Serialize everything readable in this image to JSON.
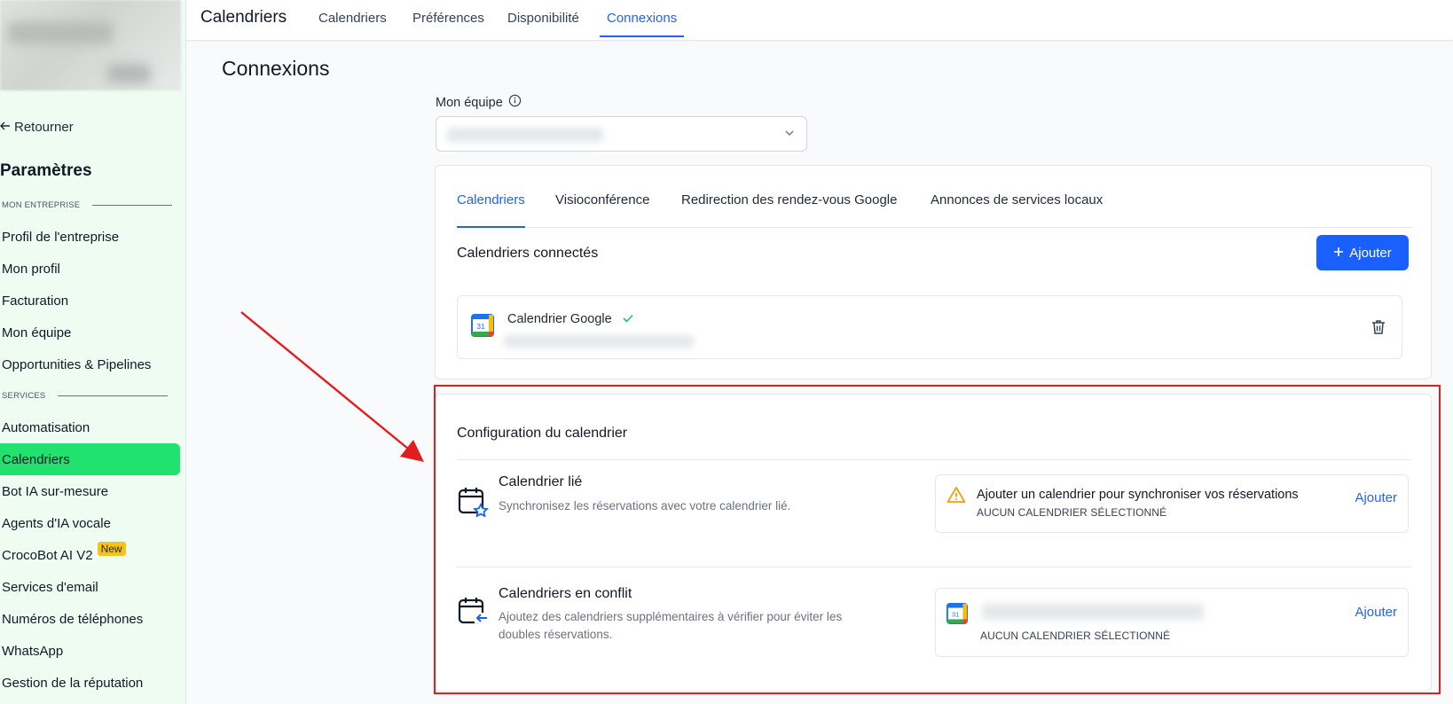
{
  "sidebar": {
    "back_label": "Retourner",
    "title": "Paramètres",
    "sections": {
      "company": "MON ENTREPRISE",
      "services": "SERVICES"
    },
    "items": [
      {
        "label": "Profil de l'entreprise"
      },
      {
        "label": "Mon profil"
      },
      {
        "label": "Facturation"
      },
      {
        "label": "Mon équipe"
      },
      {
        "label": "Opportunities & Pipelines"
      },
      {
        "label": "Automatisation"
      },
      {
        "label": "Calendriers",
        "active": true
      },
      {
        "label": "Bot IA sur-mesure"
      },
      {
        "label": "Agents d'IA vocale"
      },
      {
        "label": "CrocoBot AI V2",
        "badge": "New"
      },
      {
        "label": "Services d'email"
      },
      {
        "label": "Numéros de téléphones"
      },
      {
        "label": "WhatsApp"
      },
      {
        "label": "Gestion de la réputation"
      }
    ],
    "active_color": "#21e26f",
    "bg_color": "#effcf2"
  },
  "header": {
    "title": "Calendriers",
    "tabs": [
      {
        "label": "Calendriers"
      },
      {
        "label": "Préférences"
      },
      {
        "label": "Disponibilité"
      },
      {
        "label": "Connexions",
        "active": true
      }
    ]
  },
  "page": {
    "heading": "Connexions",
    "team_label": "Mon équipe"
  },
  "connections_card": {
    "tabs": [
      {
        "label": "Calendriers",
        "active": true
      },
      {
        "label": "Visioconférence"
      },
      {
        "label": "Redirection des rendez-vous Google"
      },
      {
        "label": "Annonces de services locaux"
      }
    ],
    "connected_title": "Calendriers connectés",
    "add_button": "Ajouter",
    "calendar": {
      "name": "Calendrier Google",
      "icon": "google-calendar-icon",
      "status": "connected"
    }
  },
  "config_card": {
    "title": "Configuration du calendrier",
    "linked": {
      "title": "Calendrier lié",
      "description": "Synchronisez les réservations avec votre calendrier lié.",
      "message": "Ajouter un calendrier pour synchroniser vos réservations",
      "status": "AUCUN CALENDRIER SÉLECTIONNÉ",
      "action": "Ajouter"
    },
    "conflict": {
      "title": "Calendriers en conflit",
      "description": "Ajoutez des calendriers supplémentaires à vérifier pour éviter les doubles réservations.",
      "status": "AUCUN CALENDRIER SÉLECTIONNÉ",
      "action": "Ajouter"
    }
  },
  "colors": {
    "accent": "#2563eb",
    "primary_button": "#1a5fff",
    "highlight_border": "#e11d1d",
    "warning": "#f59e0b",
    "success": "#22c55e"
  }
}
